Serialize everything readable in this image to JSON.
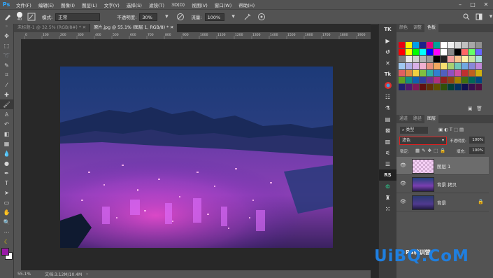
{
  "app": {
    "logo": "Ps",
    "menu": [
      "文件(F)",
      "编辑(E)",
      "图像(I)",
      "图层(L)",
      "文字(Y)",
      "选择(S)",
      "滤镜(T)",
      "3D(D)",
      "视图(V)",
      "窗口(W)",
      "帮助(H)"
    ]
  },
  "options": {
    "brush_size": "40",
    "mode_label": "模式:",
    "mode_value": "正常",
    "opacity_label": "不透明度:",
    "opacity_value": "30%",
    "flow_label": "流量:",
    "flow_value": "100%"
  },
  "tabs": [
    {
      "label": "未标题-1 @ 32.5% (RGB/8#) *"
    },
    {
      "label": "原片.jpg @ 55.1% (图层 1, RGB/8) *"
    }
  ],
  "ruler_ticks": [
    "0",
    "100",
    "200",
    "300",
    "400",
    "500",
    "600",
    "700",
    "800",
    "900",
    "1000",
    "1100",
    "1200",
    "1300",
    "1400",
    "1500",
    "1600",
    "1700",
    "1800",
    "1900"
  ],
  "status": {
    "zoom": "55.1%",
    "doc": "文档:3.12M/10.4M"
  },
  "strip_icons": [
    "TK",
    "play",
    "lasso",
    "tool-x",
    "Tk",
    "chrome",
    "fx-1",
    "fx-2",
    "fx-3",
    "fx-4",
    "fx-5",
    "sliders",
    "stack",
    "RS",
    "C",
    "paint",
    "grid"
  ],
  "swatch_panel": {
    "tabs": [
      "颜色",
      "调整",
      "色板"
    ],
    "colors": [
      [
        "#e60012",
        "#fff100",
        "#00a0e9",
        "#1d2088",
        "#e4007f",
        "#00a29a",
        "#ffffff",
        "#f0f0f0",
        "#d8d8d8",
        "#c0c0c0",
        "#a8a8a8",
        "#909090"
      ],
      [
        "#ff0000",
        "#ffff00",
        "#00ff00",
        "#00ffff",
        "#0000ff",
        "#ff00ff",
        "#ffffff",
        "#888888",
        "#000000",
        "#ff6666",
        "#66ff66",
        "#6666ff"
      ],
      [
        "#7d7d7d",
        "#e8e8e8",
        "#cfcfcf",
        "#b3b3b3",
        "#999999",
        "#000000",
        "#222222",
        "#f5a0a0",
        "#f7c28e",
        "#fff2a8",
        "#c7e5a0",
        "#a8e0d8"
      ],
      [
        "#a0c8f0",
        "#b0b0e8",
        "#d8b0e8",
        "#f0b0d0",
        "#e89080",
        "#f0a860",
        "#f8e070",
        "#a8d070",
        "#70c8b8",
        "#70a8e0",
        "#8888d8",
        "#c088d8"
      ],
      [
        "#e06060",
        "#e08840",
        "#f0d040",
        "#80c040",
        "#30b0a0",
        "#3080d0",
        "#5060c0",
        "#9050c0",
        "#d050a0",
        "#c03030",
        "#c06020",
        "#d0b010"
      ],
      [
        "#60a020",
        "#109080",
        "#1060b0",
        "#3040a0",
        "#703090",
        "#b03080",
        "#902020",
        "#904010",
        "#a08000",
        "#407010",
        "#006858",
        "#004880"
      ],
      [
        "#202070",
        "#501870",
        "#801858",
        "#601010",
        "#603008",
        "#605000",
        "#305008",
        "#004038",
        "#003060",
        "#101050",
        "#380e50",
        "#500e40"
      ]
    ]
  },
  "layers_panel": {
    "tabs": [
      "通道",
      "路径",
      "图层"
    ],
    "filter_label": "类型",
    "blend_mode": "滤色",
    "opacity_label": "不透明度:",
    "opacity_value": "100%",
    "lock_label": "锁定:",
    "fill_label": "填充:",
    "fill_value": "100%",
    "layers": [
      {
        "name": "图层 1",
        "thumb": "checker",
        "selected": true
      },
      {
        "name": "背景 拷贝",
        "thumb": "photo",
        "selected": false
      },
      {
        "name": "背景",
        "thumb": "photo",
        "selected": false,
        "locked": true
      }
    ]
  },
  "watermark": "UiBQ.CoM",
  "wechat_text": "PS转训营",
  "colors": {
    "ui_dark": "#282828",
    "ui_mid": "#535353",
    "highlight": "#e02020",
    "accent": "#31a8ff",
    "fg_color": "#9a1aa8",
    "bg_color": "#ffffff"
  }
}
